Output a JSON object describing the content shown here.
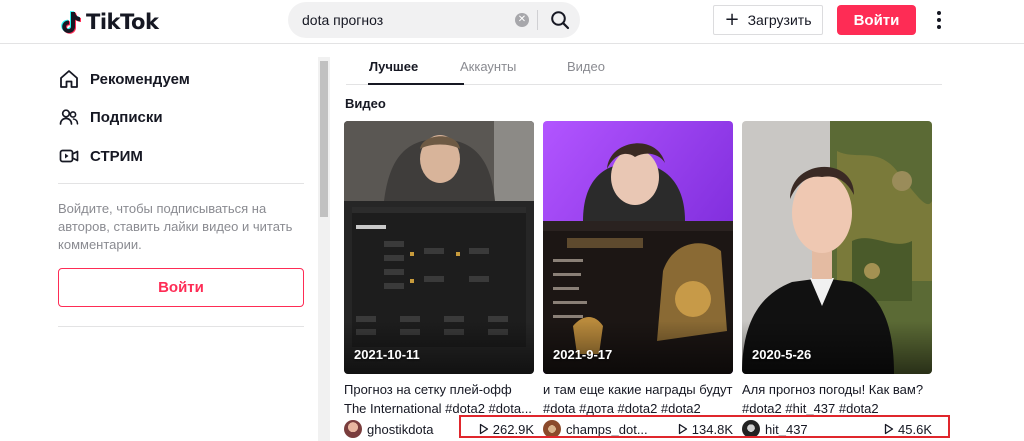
{
  "header": {
    "logo_text": "TikTok",
    "search": {
      "value": "dota прогноз"
    },
    "upload_label": "Загрузить",
    "login_label": "Войти"
  },
  "sidebar": {
    "items": [
      {
        "label": "Рекомендуем",
        "icon": "home-icon"
      },
      {
        "label": "Подписки",
        "icon": "users-icon"
      },
      {
        "label": "СТРИМ",
        "icon": "live-icon"
      }
    ],
    "login_hint": "Войдите, чтобы подписываться на авторов, ставить лайки видео и читать комментарии.",
    "login_label": "Войти"
  },
  "main": {
    "tabs": [
      {
        "label": "Лучшее",
        "active": true
      },
      {
        "label": "Аккаунты",
        "active": false
      },
      {
        "label": "Видео",
        "active": false
      }
    ],
    "section_title": "Видео",
    "videos": [
      {
        "date": "2021-10-11",
        "title_line1": "Прогноз на сетку плей-офф",
        "title_line2": "The International #dota2 #dota...",
        "author": "ghostikdota",
        "views": "262.9K"
      },
      {
        "date": "2021-9-17",
        "title_line1": "и там еще какие награды будут",
        "title_line2": "#dota #дота #dota2 #dota2",
        "author": "champs_dot...",
        "views": "134.8K"
      },
      {
        "date": "2020-5-26",
        "title_line1": "Аля прогноз погоды! Как вам?",
        "title_line2": "#dota2 #hit_437 #dota2",
        "author": "hit_437",
        "views": "45.6K"
      }
    ]
  },
  "colors": {
    "brand": "#fe2c55",
    "highlight_border": "#e0262c"
  }
}
